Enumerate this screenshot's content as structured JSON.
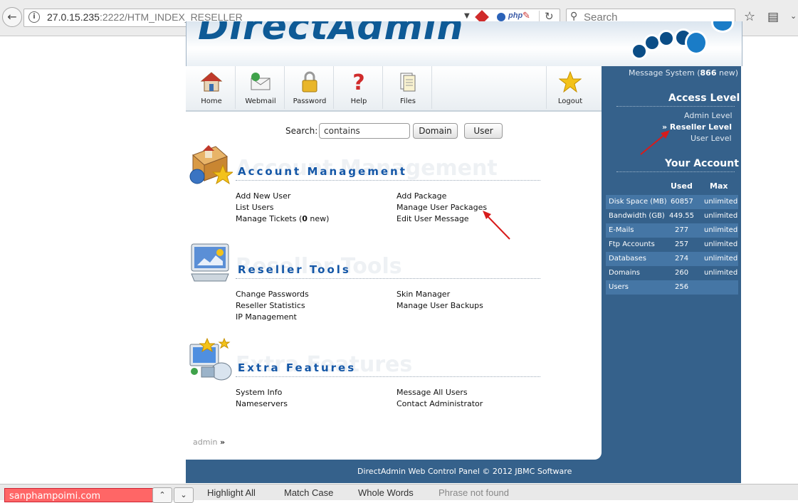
{
  "browser": {
    "url_host": "27.0.15.235",
    "url_rest": ":2222/HTM_INDEX_RESELLER",
    "search_placeholder": "Search",
    "ext_php": "php"
  },
  "header": {
    "logo_text": "DirectAdmin"
  },
  "nav": {
    "items": [
      {
        "label": "Home"
      },
      {
        "label": "Webmail"
      },
      {
        "label": "Password"
      },
      {
        "label": "Help"
      },
      {
        "label": "Files"
      }
    ],
    "logout_label": "Logout"
  },
  "search": {
    "label": "Search:",
    "value": "contains",
    "domain_button": "Domain",
    "user_button": "User"
  },
  "sections": [
    {
      "title": "Account Management",
      "ghost": "Account Management",
      "left_links": [
        "Add New User",
        "List Users"
      ],
      "tickets": {
        "prefix": "Manage Tickets (",
        "count": "0",
        "suffix": " new)"
      },
      "right_links": [
        "Add Package",
        "Manage User Packages",
        "Edit User Message"
      ]
    },
    {
      "title": "Reseller Tools",
      "ghost": "Reseller Tools",
      "left_links": [
        "Change Passwords",
        "Reseller Statistics",
        "IP Management"
      ],
      "right_links": [
        "Skin Manager",
        "Manage User Backups"
      ]
    },
    {
      "title": "Extra Features",
      "ghost": "Extra Features",
      "left_links": [
        "System Info",
        "Nameservers"
      ],
      "right_links": [
        "Message All Users",
        "Contact Administrator"
      ]
    }
  ],
  "breadcrumb": {
    "user": "admin",
    "sep": "»"
  },
  "sidebar": {
    "message_system": {
      "prefix": "Message System (",
      "count": "866",
      "suffix": " new)"
    },
    "access_level_heading": "Access Level",
    "levels": {
      "admin": "Admin Level",
      "reseller": "» Reseller Level",
      "user": "User Level"
    },
    "your_account_heading": "Your Account",
    "table_headers": {
      "used": "Used",
      "max": "Max"
    },
    "usage": [
      {
        "name": "Disk Space (MB)",
        "used": "60857",
        "max": "unlimited"
      },
      {
        "name": "Bandwidth (GB)",
        "used": "449.55",
        "max": "unlimited"
      },
      {
        "name": "E-Mails",
        "used": "277",
        "max": "unlimited"
      },
      {
        "name": "Ftp Accounts",
        "used": "257",
        "max": "unlimited"
      },
      {
        "name": "Databases",
        "used": "274",
        "max": "unlimited"
      },
      {
        "name": "Domains",
        "used": "260",
        "max": "unlimited"
      },
      {
        "name": "Users",
        "used": "256",
        "max": ""
      }
    ]
  },
  "footer": {
    "text": "DirectAdmin Web Control Panel © 2012 JBMC Software"
  },
  "findbar": {
    "query": "sanphampoimi.com",
    "highlight_all": "Highlight All",
    "match_case": "Match Case",
    "whole_words": "Whole Words",
    "status": "Phrase not found"
  },
  "colors": {
    "sidebar_bg": "#35618b",
    "section_title": "#1457a7",
    "annotation_arrow": "#d81b1b"
  }
}
